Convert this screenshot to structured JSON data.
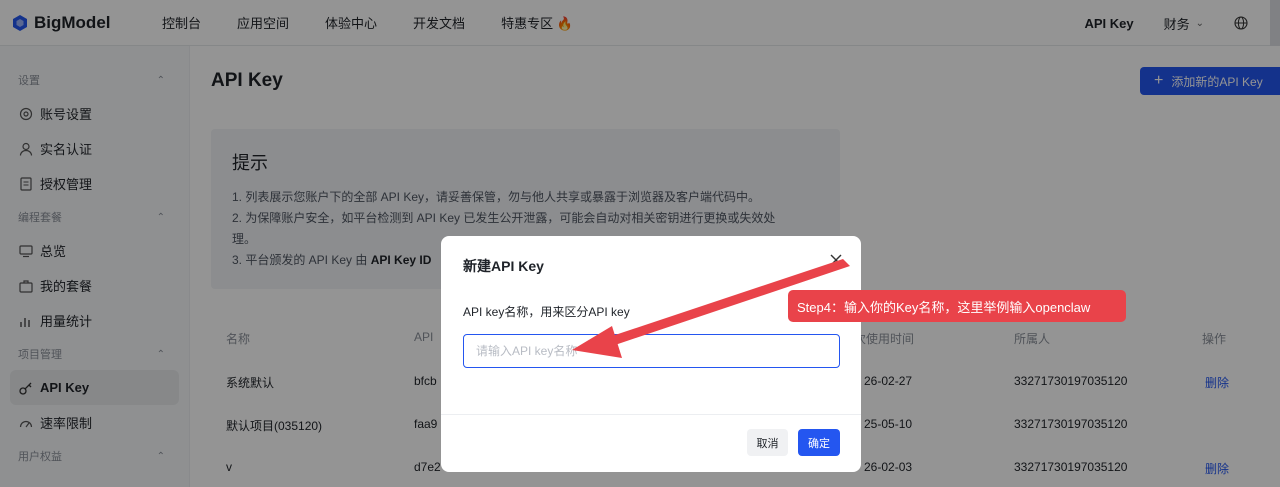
{
  "brand": {
    "name": "BigModel"
  },
  "nav": {
    "items": [
      "控制台",
      "应用空间",
      "体验中心",
      "开发文档",
      "特惠专区 🔥"
    ],
    "api_key": "API Key",
    "finance": "财务"
  },
  "sidebar": {
    "groups": {
      "settings": "设置",
      "coding_plan": "编程套餐",
      "project": "项目管理",
      "user_rights": "用户权益"
    },
    "items": {
      "account": "账号设置",
      "realname": "实名认证",
      "auth": "授权管理",
      "overview": "总览",
      "my_plan": "我的套餐",
      "usage": "用量统计",
      "api_key": "API Key",
      "rate_limit": "速率限制"
    }
  },
  "main": {
    "title": "API Key",
    "add_button": "添加新的API Key",
    "tips": {
      "title": "提示",
      "line1": "1. 列表展示您账户下的全部 API Key，请妥善保管，勿与他人共享或暴露于浏览器及客户端代码中。",
      "line2a": "2. 为保障账户安全，如平台检测到 API Key 已发生公开泄露，可能会自动对相关密钥进行更换或失效处",
      "line2b": "理。",
      "line3_prefix": "3. 平台颁发的 API Key 由",
      "line3_bold": "API Key ID"
    },
    "table": {
      "headers": {
        "name": "名称",
        "key": "API",
        "last_used": "次使用时间",
        "owner": "所属人",
        "action": "操作"
      },
      "rows": [
        {
          "name": "系统默认",
          "key": "bfcb",
          "last_used": "26-02-27",
          "owner": "33271730197035120",
          "action": "删除"
        },
        {
          "name": "默认项目(035120)",
          "key": "faa9",
          "last_used": "25-05-10",
          "owner": "33271730197035120",
          "action": ""
        },
        {
          "name": "v",
          "key": "d7e2",
          "last_used": "26-02-03",
          "owner": "33271730197035120",
          "action": "删除"
        }
      ]
    }
  },
  "dialog": {
    "title": "新建API Key",
    "label": "API key名称，用来区分API key",
    "placeholder": "请输入API key名称",
    "cancel": "取消",
    "confirm": "确定"
  },
  "annotation": {
    "text": "Step4：输入你的Key名称，这里举例输入openclaw"
  },
  "colors": {
    "accent": "#2456f0",
    "annotation": "#e9434a"
  }
}
